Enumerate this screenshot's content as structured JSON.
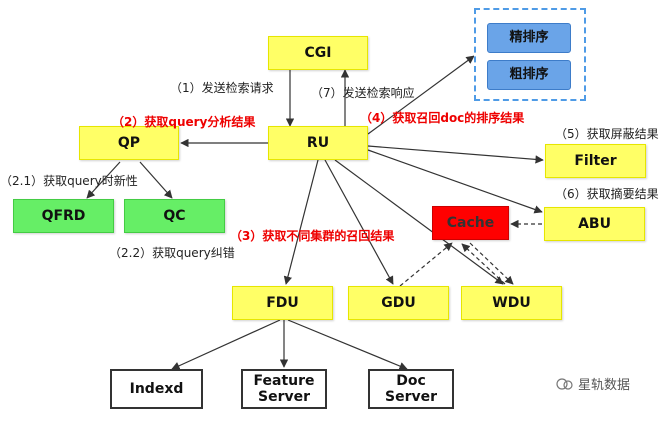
{
  "nodes": {
    "cgi": "CGI",
    "ru": "RU",
    "qp": "QP",
    "qfrd": "QFRD",
    "qc": "QC",
    "filter": "Filter",
    "abu": "ABU",
    "cache": "Cache",
    "fdu": "FDU",
    "gdu": "GDU",
    "wdu": "WDU",
    "indexd": "Indexd",
    "feature_server": "Feature\nServer",
    "doc_server": "Doc\nServer",
    "fine_rank": "精排序",
    "coarse_rank": "粗排序"
  },
  "labels": {
    "l1": "（1）发送检索请求",
    "l7": "（7）发送检索响应",
    "l2": "（2）获取query分析结果",
    "l4": "（4）获取召回doc的排序结果",
    "l5": "（5）获取屏蔽结果",
    "l21": "（2.1）获取query时新性",
    "l6": "（6）获取摘要结果",
    "l3": "（3）获取不同集群的召回结果",
    "l22": "（2.2）获取query纠错"
  },
  "brand": "星轨数据",
  "colors": {
    "highlight_label": "#ee0000",
    "yellow_node": "#ffff66",
    "green_node": "#66ee66",
    "cache_node": "#ff0000",
    "rank_group_border": "#4f9be6",
    "rank_box": "#6aa4e8"
  }
}
